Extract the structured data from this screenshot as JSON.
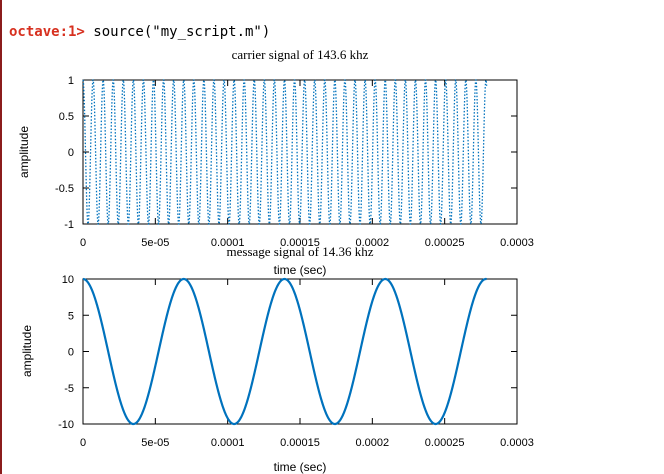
{
  "terminal": {
    "prompt": "octave:1>",
    "command": " source(\"my_script.m\")"
  },
  "chart_data": [
    {
      "type": "line",
      "title": "carrier signal of 143.6 khz",
      "xlabel": "time (sec)",
      "ylabel": "amplitude",
      "xlim": [
        0,
        0.0003
      ],
      "ylim": [
        -1,
        1
      ],
      "xticks": [
        "0",
        "5e-05",
        "0.0001",
        "0.00015",
        "0.0002",
        "0.00025",
        "0.0003"
      ],
      "yticks": [
        "1",
        "0.5",
        "0",
        "-0.5",
        "-1"
      ],
      "series": [
        {
          "amplitude": 1,
          "frequency_hz": 143600,
          "x_end": 0.000279,
          "color": "#0072bd",
          "style": "dotted"
        }
      ]
    },
    {
      "type": "line",
      "title": "message signal of 14.36 khz",
      "xlabel": "time (sec)",
      "ylabel": "amplitude",
      "xlim": [
        0,
        0.0003
      ],
      "ylim": [
        -10,
        10
      ],
      "xticks": [
        "0",
        "5e-05",
        "0.0001",
        "0.00015",
        "0.0002",
        "0.00025",
        "0.0003"
      ],
      "yticks": [
        "10",
        "5",
        "0",
        "-5",
        "-10"
      ],
      "series": [
        {
          "amplitude": 10,
          "frequency_hz": 14360,
          "x_end": 0.000279,
          "color": "#0072bd",
          "style": "solid"
        }
      ]
    }
  ]
}
